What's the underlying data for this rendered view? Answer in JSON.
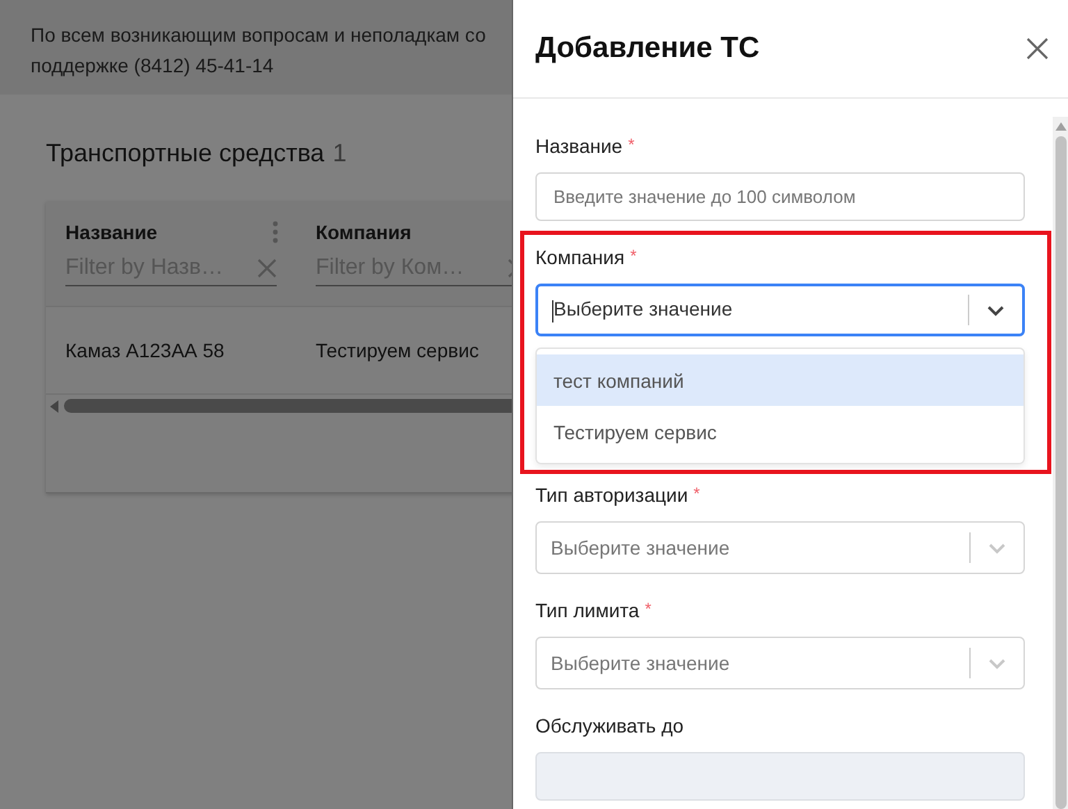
{
  "banner": {
    "lines": [
      "По всем возникающим вопросам и неполадкам со",
      "поддержке (8412) 45-41-14"
    ]
  },
  "page": {
    "title": "Транспортные средства",
    "count": "1"
  },
  "table": {
    "columns": [
      {
        "label": "Название",
        "filter_placeholder": "Filter by Назв…"
      },
      {
        "label": "Компания",
        "filter_placeholder": "Filter by Ком…"
      }
    ],
    "rows": [
      [
        "Камаз А123АА 58",
        "Тестируем сервис"
      ]
    ]
  },
  "drawer": {
    "title": "Добавление ТС",
    "fields": [
      {
        "kind": "input",
        "label": "Название",
        "required_mark": "*",
        "placeholder": "Введите значение до 100 символом",
        "disabled": false
      },
      {
        "kind": "select",
        "label": "Компания",
        "required_mark": "*",
        "placeholder": "Выберите значение",
        "focused": true,
        "expanded": true,
        "options": [
          {
            "label": "тест компаний",
            "selected": true
          },
          {
            "label": "Тестируем сервис",
            "selected": false
          }
        ]
      },
      {
        "kind": "select",
        "label": "Тип авторизации",
        "required_mark": "*",
        "placeholder": "Выберите значение",
        "focused": false,
        "expanded": false
      },
      {
        "kind": "select",
        "label": "Тип лимита",
        "required_mark": "*",
        "placeholder": "Выберите значение",
        "focused": false,
        "expanded": false
      },
      {
        "kind": "input",
        "label": "Обслуживать до",
        "disabled": true
      }
    ]
  }
}
